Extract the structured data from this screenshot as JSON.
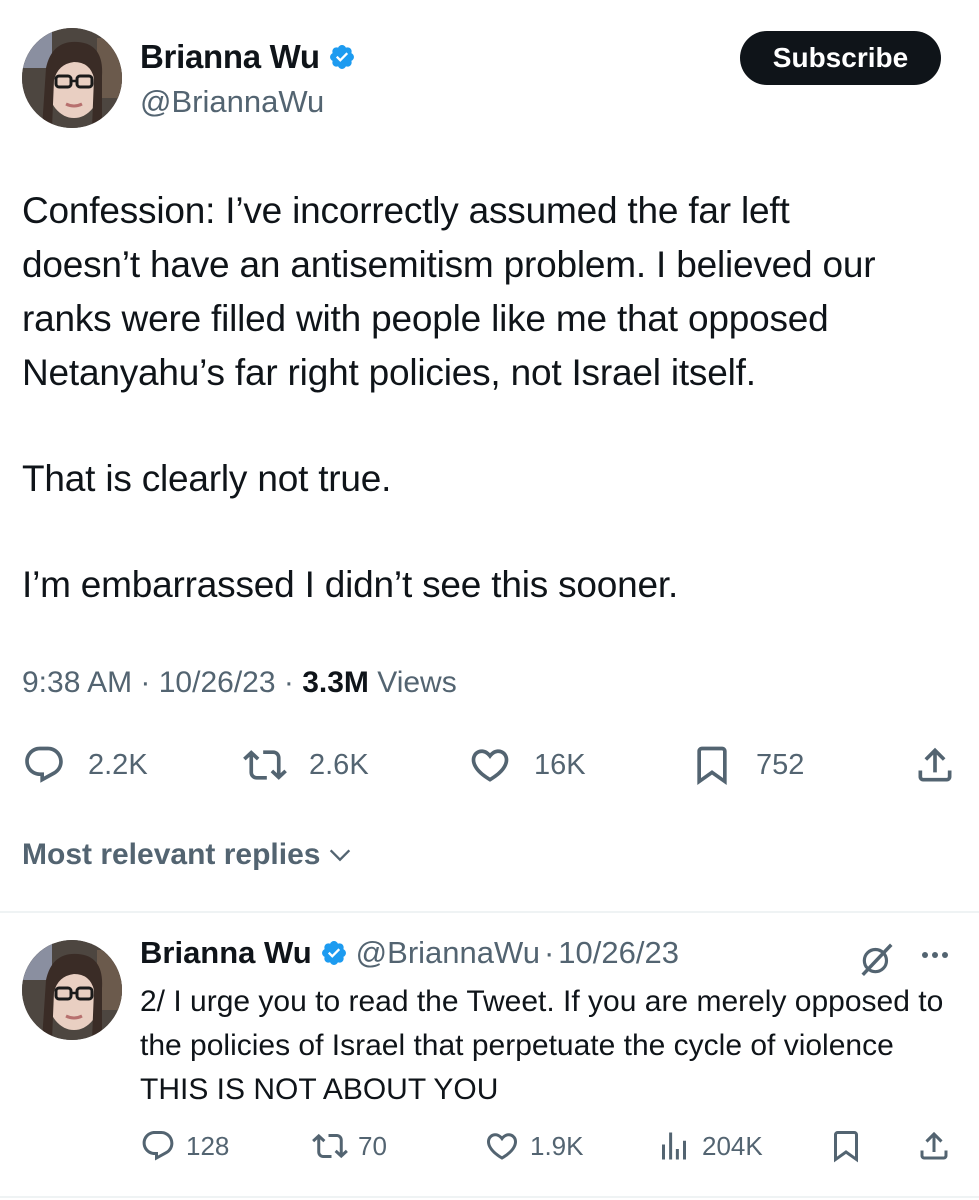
{
  "tweet": {
    "author": {
      "name": "Brianna Wu",
      "handle": "@BriannaWu",
      "verified_color": "#1d9bf0"
    },
    "subscribe_label": "Subscribe",
    "paragraphs": [
      "Confession: I’ve incorrectly assumed the far left\ndoesn’t have an antisemitism problem. I believed our\nranks were filled with people like me that opposed\nNetanyahu’s far right policies, not Israel itself.",
      "That is clearly not true.",
      "I’m embarrassed I didn’t see this sooner."
    ],
    "meta": {
      "time": "9:38 AM",
      "sep1": " · ",
      "date": "10/26/23",
      "sep2": " · ",
      "views_count": "3.3M",
      "views_label": " Views"
    },
    "actions": {
      "replies": "2.2K",
      "retweets": "2.6K",
      "likes": "16K",
      "bookmarks": "752"
    }
  },
  "replies_filter": {
    "label": "Most relevant replies"
  },
  "reply": {
    "author": {
      "name": "Brianna Wu",
      "handle": "@BriannaWu",
      "sep": "·",
      "date": "10/26/23"
    },
    "text": "2/ I urge you to read the Tweet. If you are merely opposed to the policies of Israel that perpetuate the cycle of violence THIS IS NOT ABOUT YOU",
    "actions": {
      "replies": "128",
      "retweets": "70",
      "likes": "1.9K",
      "views": "204K"
    }
  },
  "icons": {
    "verified": "verified-badge-icon",
    "reply": "speech-bubble-icon",
    "retweet": "retweet-arrows-icon",
    "like": "heart-icon",
    "bookmark": "bookmark-icon",
    "share": "share-upload-icon",
    "views": "bar-chart-icon",
    "grok": "grok-slash-icon",
    "more": "ellipsis-icon",
    "chevron": "chevron-down-icon"
  },
  "colors": {
    "text": "#0f1419",
    "secondary": "#536471",
    "button_bg": "#0f1419",
    "divider": "#eff3f4"
  }
}
